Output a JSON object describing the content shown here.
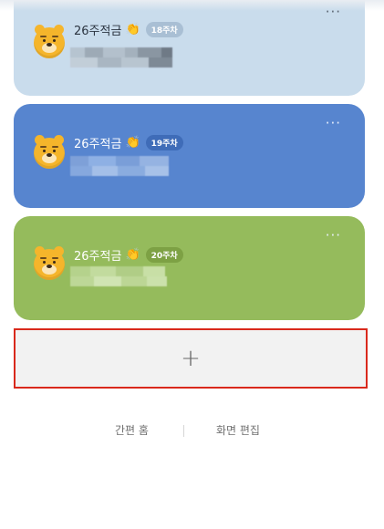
{
  "cards": [
    {
      "title": "26주적금",
      "badge": "18주차",
      "more_label": "···"
    },
    {
      "title": "26주적금",
      "badge": "19주차",
      "more_label": "···"
    },
    {
      "title": "26주적금",
      "badge": "20주차",
      "more_label": "···"
    }
  ],
  "add_card": {
    "label": "+"
  },
  "footer": {
    "easy_home": "간편 홈",
    "edit_screen": "화면 편집"
  },
  "colors": {
    "card_1": "#c9dcec",
    "card_2": "#5785cf",
    "card_3": "#95bb5c",
    "highlight_border": "#d9291c"
  },
  "icons": {
    "avatar": "ryan-character-icon",
    "clap": "clapping-hands-icon",
    "more": "more-options-icon"
  }
}
